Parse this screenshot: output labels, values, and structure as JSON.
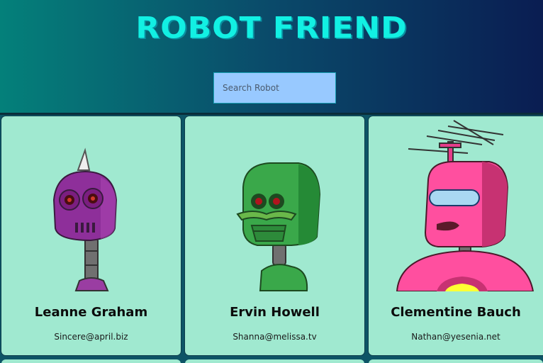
{
  "header": {
    "title": "ROBOT FRIEND",
    "search_placeholder": "Search Robot"
  },
  "colors": {
    "title": "#12f0e3",
    "card_bg": "#a0e9d0",
    "search_bg": "#98c9ff"
  },
  "robots": [
    {
      "name": "Leanne Graham",
      "email": "Sincere@april.biz",
      "icon": "purple-robot-avatar"
    },
    {
      "name": "Ervin Howell",
      "email": "Shanna@melissa.tv",
      "icon": "green-robot-avatar"
    },
    {
      "name": "Clementine Bauch",
      "email": "Nathan@yesenia.net",
      "icon": "pink-robot-avatar"
    }
  ]
}
